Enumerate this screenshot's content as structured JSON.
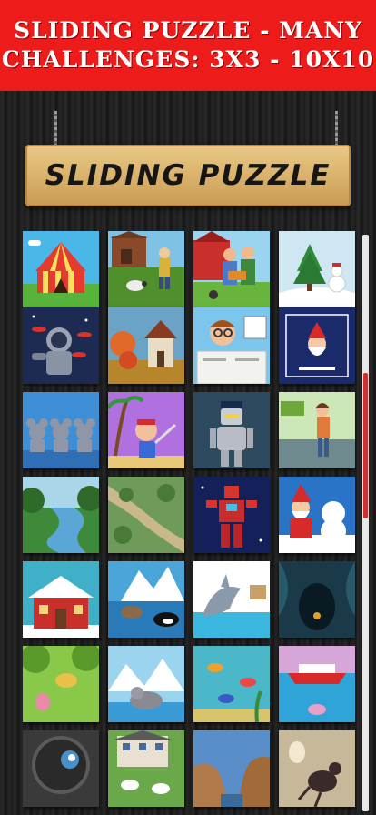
{
  "banner": {
    "line1": "SLIDING PUZZLE - MANY",
    "line2": "CHALLENGES: 3X3 - 10X10",
    "background": "#ee1b1b"
  },
  "sign": {
    "title": "SLIDING PUZZLE"
  },
  "puzzles": [
    {
      "icon": "circus-tent-picture"
    },
    {
      "icon": "farm-boy-sheep-picture"
    },
    {
      "icon": "farmer-family-picture"
    },
    {
      "icon": "snowman-christmas-tree-picture"
    },
    {
      "icon": "astronaut-picture"
    },
    {
      "icon": "autumn-house-picture"
    },
    {
      "icon": "man-reading-newspaper-picture"
    },
    {
      "icon": "santa-christmas-card-picture"
    },
    {
      "icon": "three-mice-picture"
    },
    {
      "icon": "pirate-boy-picture"
    },
    {
      "icon": "robot-police-picture"
    },
    {
      "icon": "woman-kitchen-picture"
    },
    {
      "icon": "river-forest-picture"
    },
    {
      "icon": "river-map-picture"
    },
    {
      "icon": "red-robot-space-picture"
    },
    {
      "icon": "santa-polar-bear-picture"
    },
    {
      "icon": "santa-snow-house-picture"
    },
    {
      "icon": "orca-seal-iceberg-picture"
    },
    {
      "icon": "shark-jump-picture"
    },
    {
      "icon": "underwater-cave-picture"
    },
    {
      "icon": "jungle-animals-picture"
    },
    {
      "icon": "walrus-iceberg-picture"
    },
    {
      "icon": "underwater-scene-picture"
    },
    {
      "icon": "cruise-ship-ocean-picture"
    },
    {
      "icon": "cannon-bird-picture"
    },
    {
      "icon": "farm-house-cows-picture"
    },
    {
      "icon": "canyon-landscape-picture"
    },
    {
      "icon": "beetle-egg-picture"
    }
  ]
}
